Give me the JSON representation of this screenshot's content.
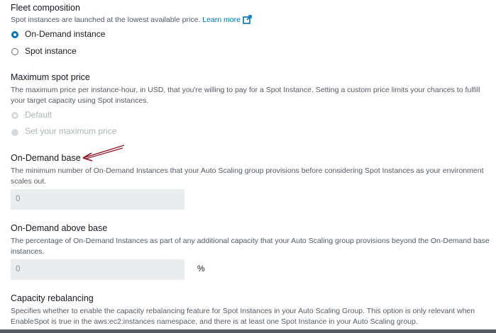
{
  "fleet": {
    "title": "Fleet composition",
    "desc": "Spot instances are launched at the lowest available price.",
    "learn_more": "Learn more",
    "options": [
      "On-Demand instance",
      "Spot instance"
    ],
    "selected": "On-Demand instance"
  },
  "max_spot": {
    "title": "Maximum spot price",
    "desc": "The maximum price per instance-hour, in USD, that you're willing to pay for a Spot Instance. Setting a custom price limits your chances to fulfill your target capacity using Spot instances.",
    "options": [
      "Default",
      "Set your maximum price"
    ]
  },
  "od_base": {
    "title": "On-Demand base",
    "desc": "The minimum number of On-Demand Instances that your Auto Scaling group provisions before considering Spot Instances as your environment scales out.",
    "value": "0"
  },
  "od_above": {
    "title": "On-Demand above base",
    "desc": "The percentage of On-Demand Instances as part of any additional capacity that your Auto Scaling group provisions beyond the On-Demand base instances.",
    "value": "0",
    "unit": "%"
  },
  "rebalance": {
    "title": "Capacity rebalancing",
    "desc": "Specifies whether to enable the capacity rebalancing feature for Spot Instances in your Auto Scaling Group. This option is only relevant when EnableSpot is true in the aws:ec2:instances namespace, and there is at least one Spot Instance in your Auto Scaling group."
  },
  "colors": {
    "link": "#0073bb",
    "annotation_arrow": "#8b1a2b",
    "input_bg": "#eaeded"
  }
}
